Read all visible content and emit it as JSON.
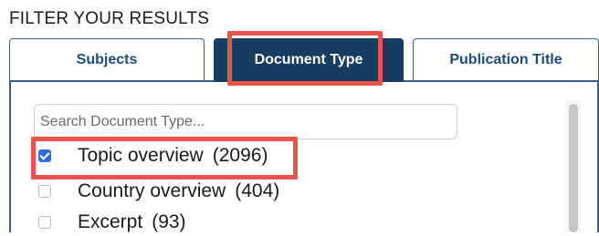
{
  "filter": {
    "heading": "FILTER YOUR RESULTS",
    "tabs": [
      {
        "label": "Subjects",
        "active": false
      },
      {
        "label": "Document Type",
        "active": true
      },
      {
        "label": "Publication Title",
        "active": false
      }
    ],
    "search": {
      "placeholder": "Search Document Type...",
      "value": ""
    },
    "options": [
      {
        "label": "Topic overview",
        "count": "(2096)",
        "checked": true
      },
      {
        "label": "Country overview",
        "count": "(404)",
        "checked": false
      },
      {
        "label": "Excerpt",
        "count": "(93)",
        "checked": false
      }
    ]
  },
  "colors": {
    "active_tab_bg": "#163c5f",
    "tab_border": "#3a5f86",
    "highlight": "#e8534b",
    "checkbox_checked": "#2f6cdc"
  }
}
